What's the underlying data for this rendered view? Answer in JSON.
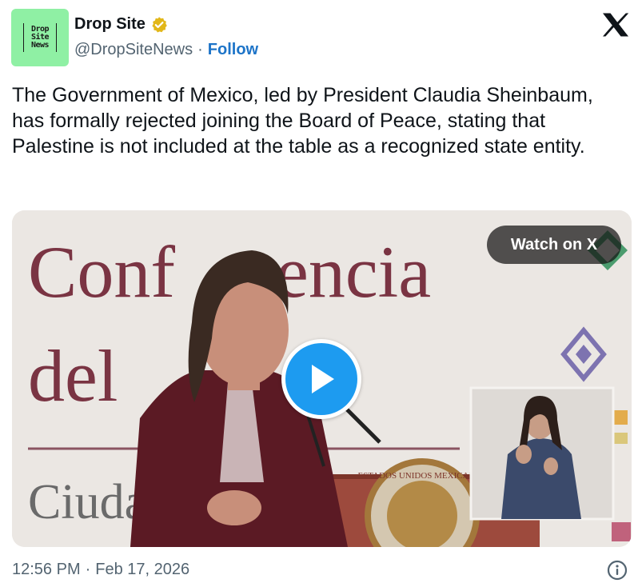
{
  "author": {
    "avatar_text": [
      "Drop",
      "Site",
      "News"
    ],
    "name": "Drop Site",
    "verified_icon": "verified-badge-icon",
    "handle": "@DropSiteNews",
    "separator": "·",
    "follow_label": "Follow"
  },
  "platform_icon": "x-logo-icon",
  "tweet": {
    "text": "The Government of Mexico, led by President Claudia Sheinbaum, has formally rejected joining the Board of Peace, stating that Palestine is not included at the table as a recognized state entity."
  },
  "media": {
    "watch_label": "Watch on X",
    "backdrop_text": [
      "Conf",
      "encia",
      "del",
      "Ciuda"
    ],
    "seal_text": "ESTADOS UNIDOS MEXICANOS",
    "play_icon": "play-icon"
  },
  "footer": {
    "time": "12:56 PM",
    "separator": "·",
    "date": "Feb 17, 2026",
    "info_icon": "info-icon"
  },
  "colors": {
    "avatar_bg": "#8ff0a4",
    "verified_badge": "#e2b719",
    "follow": "#1d74c8",
    "play_button": "#1d9bf0",
    "muted_text": "#536471"
  }
}
